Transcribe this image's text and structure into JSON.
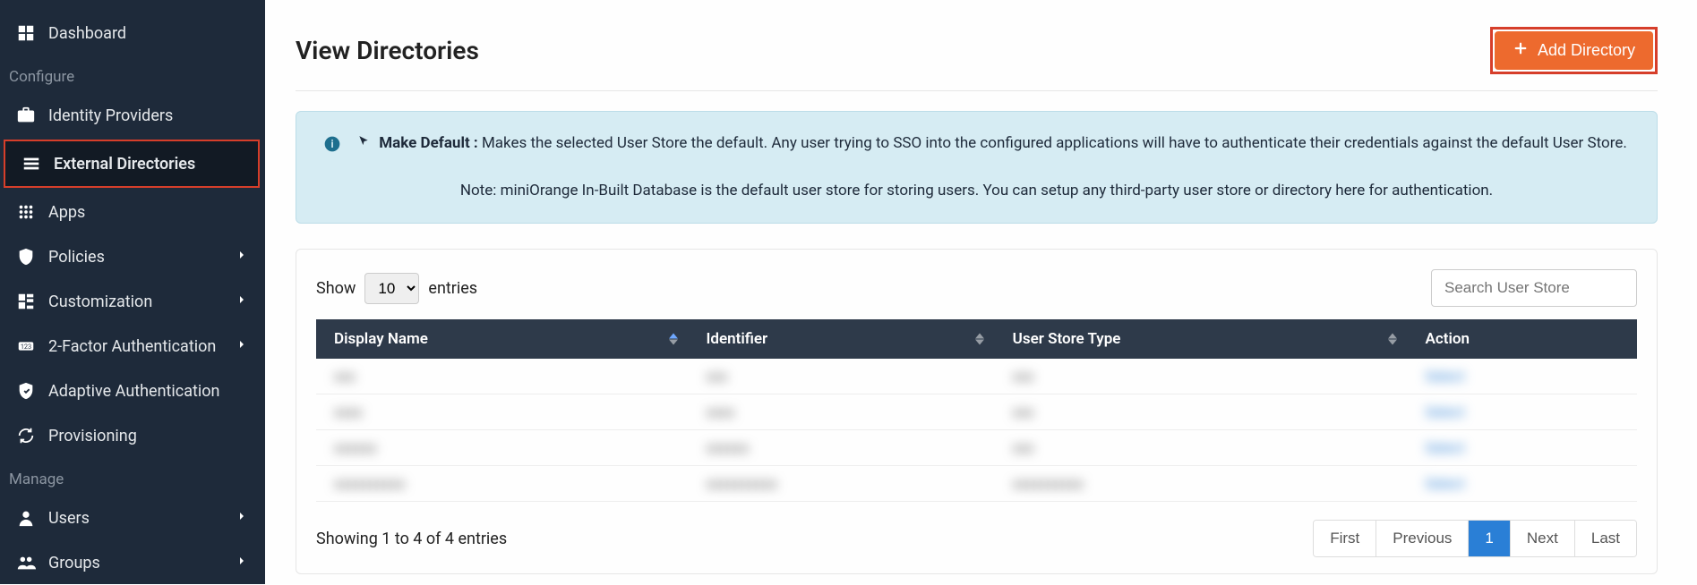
{
  "sidebar": {
    "topItem": {
      "label": "Dashboard"
    },
    "configureLabel": "Configure",
    "manageLabel": "Manage",
    "items": [
      {
        "label": "Identity Providers",
        "icon": "identity",
        "chevron": false
      },
      {
        "label": "External Directories",
        "icon": "directories",
        "chevron": false,
        "active": true
      },
      {
        "label": "Apps",
        "icon": "apps",
        "chevron": false
      },
      {
        "label": "Policies",
        "icon": "policies",
        "chevron": true
      },
      {
        "label": "Customization",
        "icon": "customization",
        "chevron": true
      },
      {
        "label": "2-Factor Authentication",
        "icon": "twofa",
        "chevron": true
      },
      {
        "label": "Adaptive Authentication",
        "icon": "adaptive",
        "chevron": false
      },
      {
        "label": "Provisioning",
        "icon": "provisioning",
        "chevron": false
      }
    ],
    "manageItems": [
      {
        "label": "Users",
        "icon": "users",
        "chevron": true
      },
      {
        "label": "Groups",
        "icon": "groups",
        "chevron": true
      }
    ]
  },
  "page": {
    "title": "View Directories",
    "addButton": "Add Directory"
  },
  "info": {
    "boldLabel": "Make Default :",
    "desc": " Makes the selected User Store the default. Any user trying to SSO into the configured applications will have to authenticate their credentials against the default User Store.",
    "note": "Note: miniOrange In-Built Database is the default user store for storing users. You can setup any third-party user store or directory here for authentication."
  },
  "table": {
    "showLabel": "Show",
    "entriesLabel": "entries",
    "perPage": "10",
    "searchPlaceholder": "Search User Store",
    "columns": [
      "Display Name",
      "Identifier",
      "User Store Type",
      "Action"
    ],
    "rows": [
      {
        "c0": "xxx",
        "c1": "xxx",
        "c2": "xxx",
        "c3": "Select"
      },
      {
        "c0": "xxxx",
        "c1": "xxxx",
        "c2": "xxx",
        "c3": "Select"
      },
      {
        "c0": "xxxxxx",
        "c1": "xxxxxx",
        "c2": "xxx",
        "c3": "Select"
      },
      {
        "c0": "xxxxxxxxxx",
        "c1": "xxxxxxxxxx",
        "c2": "xxxxxxxxxx",
        "c3": "Select"
      }
    ],
    "countText": "Showing 1 to 4 of 4 entries",
    "pager": {
      "first": "First",
      "prev": "Previous",
      "page": "1",
      "next": "Next",
      "last": "Last"
    }
  }
}
